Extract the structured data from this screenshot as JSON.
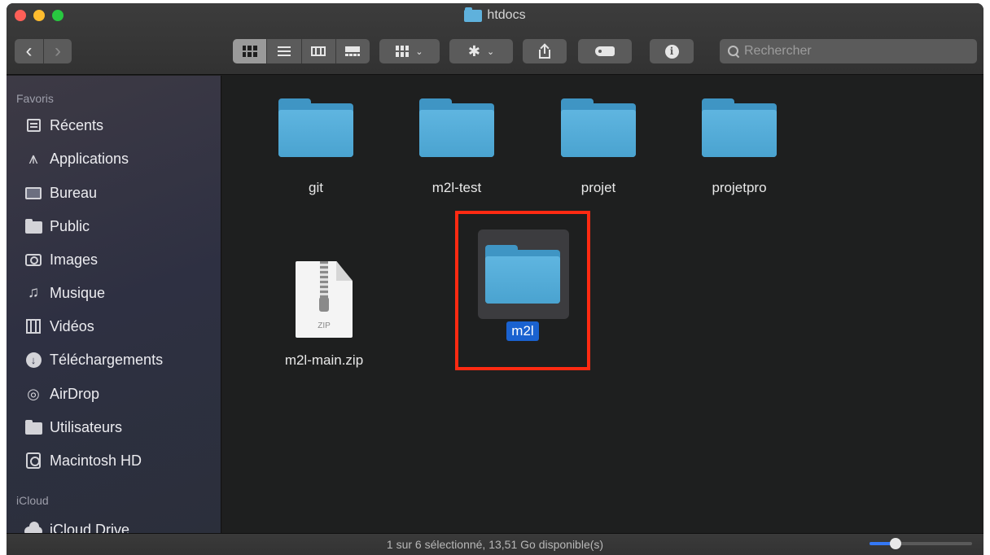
{
  "window": {
    "title": "htdocs"
  },
  "toolbar": {
    "back_label": "‹",
    "forward_label": "›",
    "search_placeholder": "Rechercher",
    "group_icon": "group-by-icon",
    "action_icon": "gear-icon",
    "share_icon": "share-icon",
    "tag_icon": "tag-icon",
    "info_icon": "info-icon"
  },
  "sidebar": {
    "favorites_title": "Favoris",
    "items": [
      {
        "label": "Récents",
        "icon": "recents-icon"
      },
      {
        "label": "Applications",
        "icon": "applications-icon"
      },
      {
        "label": "Bureau",
        "icon": "desktop-icon"
      },
      {
        "label": "Public",
        "icon": "folder-icon"
      },
      {
        "label": "Images",
        "icon": "pictures-icon"
      },
      {
        "label": "Musique",
        "icon": "music-icon"
      },
      {
        "label": "Vidéos",
        "icon": "movies-icon"
      },
      {
        "label": "Téléchargements",
        "icon": "downloads-icon"
      },
      {
        "label": "AirDrop",
        "icon": "airdrop-icon"
      },
      {
        "label": "Utilisateurs",
        "icon": "folder-icon"
      },
      {
        "label": "Macintosh HD",
        "icon": "disk-icon"
      }
    ],
    "icloud_title": "iCloud",
    "icloud_items": [
      {
        "label": "iCloud Drive",
        "icon": "cloud-icon"
      }
    ]
  },
  "content": {
    "items": [
      {
        "name": "git",
        "type": "folder"
      },
      {
        "name": "m2l-test",
        "type": "folder"
      },
      {
        "name": "projet",
        "type": "folder"
      },
      {
        "name": "projetpro",
        "type": "folder"
      },
      {
        "name": "m2l-main.zip",
        "type": "zip"
      },
      {
        "name": "m2l",
        "type": "folder",
        "selected": true
      }
    ],
    "zip_badge": "ZIP"
  },
  "statusbar": {
    "text": "1 sur 6 sélectionné, 13,51 Go disponible(s)",
    "zoom_level": 0.25
  },
  "colors": {
    "folder": "#4aa3d0",
    "selection": "#1a62d0",
    "highlight_box": "#ff2a12",
    "accent": "#3478f6"
  }
}
